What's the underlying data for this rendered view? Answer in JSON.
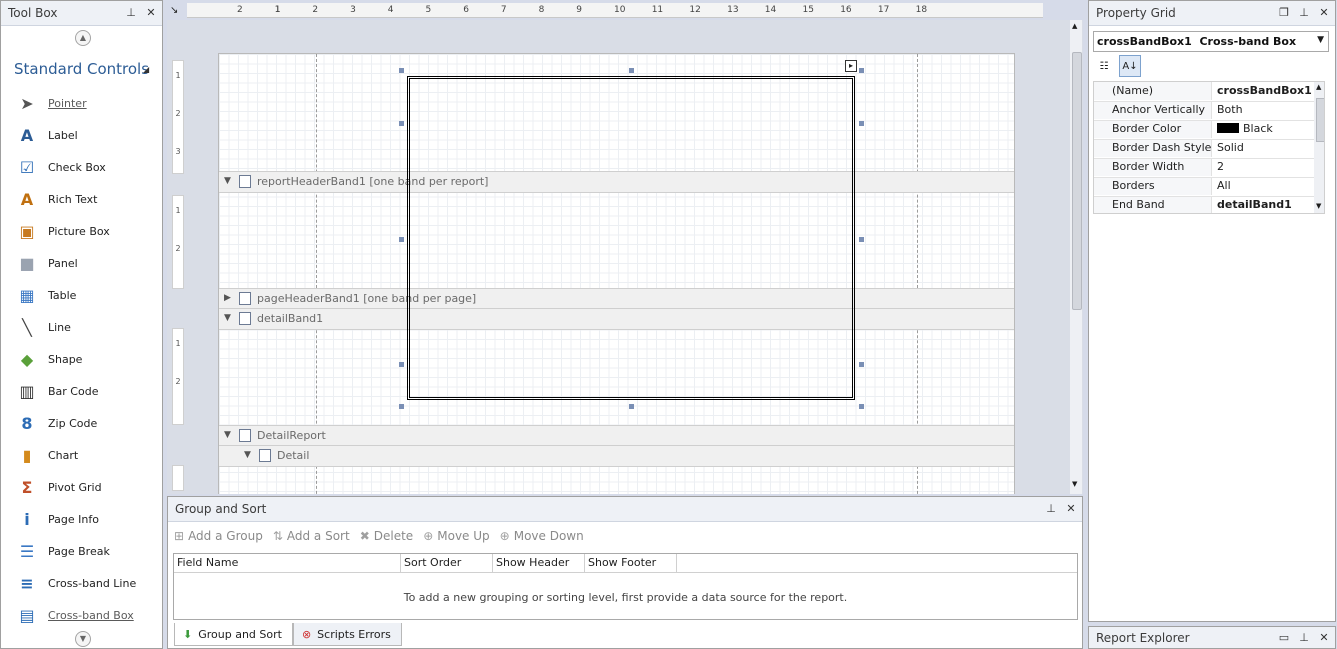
{
  "toolbox": {
    "title": "Tool Box",
    "section": "Standard Controls",
    "items": [
      {
        "label": "Pointer",
        "icon": "pointer-icon"
      },
      {
        "label": "Label",
        "icon": "label-icon"
      },
      {
        "label": "Check Box",
        "icon": "checkbox-icon"
      },
      {
        "label": "Rich Text",
        "icon": "rich-text-icon"
      },
      {
        "label": "Picture Box",
        "icon": "picture-box-icon"
      },
      {
        "label": "Panel",
        "icon": "panel-icon"
      },
      {
        "label": "Table",
        "icon": "table-icon"
      },
      {
        "label": "Line",
        "icon": "line-icon"
      },
      {
        "label": "Shape",
        "icon": "shape-icon"
      },
      {
        "label": "Bar Code",
        "icon": "barcode-icon"
      },
      {
        "label": "Zip Code",
        "icon": "zipcode-icon"
      },
      {
        "label": "Chart",
        "icon": "chart-icon"
      },
      {
        "label": "Pivot Grid",
        "icon": "pivot-grid-icon"
      },
      {
        "label": "Page Info",
        "icon": "page-info-icon"
      },
      {
        "label": "Page Break",
        "icon": "page-break-icon"
      },
      {
        "label": "Cross-band Line",
        "icon": "cross-band-line-icon"
      },
      {
        "label": "Cross-band Box",
        "icon": "cross-band-box-icon"
      }
    ]
  },
  "ruler": {
    "ticks": [
      "2",
      "1",
      "1",
      "2",
      "3",
      "4",
      "5",
      "6",
      "7",
      "8",
      "9",
      "10",
      "11",
      "12",
      "13",
      "14",
      "15",
      "16",
      "17",
      "18"
    ]
  },
  "side_ruler": {
    "marks": [
      "1",
      "2",
      "3",
      "1",
      "2",
      "1",
      "2"
    ]
  },
  "report": {
    "bands": [
      {
        "caption": "reportHeaderBand1 [one band per report]",
        "caret": "▼"
      },
      {
        "caption": "pageHeaderBand1 [one band per page]",
        "caret": "▶"
      },
      {
        "caption": "detailBand1",
        "caret": "▼"
      },
      {
        "caption": "DetailReport",
        "caret": "▼"
      },
      {
        "caption": "Detail",
        "caret": "▼"
      }
    ],
    "tag_glyph": "▸"
  },
  "group_sort": {
    "title": "Group and Sort",
    "toolbar": [
      "Add a Group",
      "Add a Sort",
      "Delete",
      "Move Up",
      "Move Down"
    ],
    "columns": [
      "Field Name",
      "Sort Order",
      "Show Header",
      "Show Footer"
    ],
    "empty_message": "To add a new grouping or sorting level, first provide a data source for the report.",
    "tabs": [
      "Group and Sort",
      "Scripts Errors"
    ]
  },
  "property_grid": {
    "title": "Property Grid",
    "selected_object": "crossBandBox1",
    "selected_type": "Cross-band Box",
    "rows": [
      {
        "name": "(Name)",
        "value": "crossBandBox1",
        "bold": true
      },
      {
        "name": "Anchor Vertically",
        "value": "Both",
        "bold": false
      },
      {
        "name": "Border Color",
        "value": "Black",
        "bold": false
      },
      {
        "name": "Border Dash Style",
        "value": "Solid",
        "bold": false
      },
      {
        "name": "Border Width",
        "value": "2",
        "bold": false
      },
      {
        "name": "Borders",
        "value": "All",
        "bold": false
      },
      {
        "name": "End Band",
        "value": "detailBand1",
        "bold": true
      }
    ],
    "border_color_hex": "#000000"
  },
  "report_explorer": {
    "title": "Report Explorer"
  },
  "colors": {
    "accent": "#2c5c95",
    "panel_title_bg": "#eef1f6",
    "workspace_bg": "#d9dde6"
  }
}
